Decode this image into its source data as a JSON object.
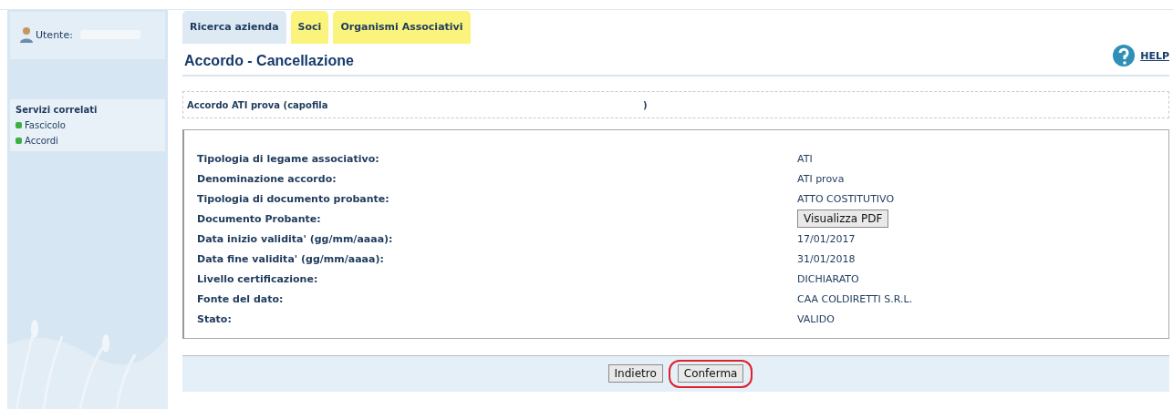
{
  "sidebar": {
    "user_label": "Utente:",
    "section_title": "Servizi correlati",
    "items": [
      {
        "label": "Fascicolo",
        "color": "#3cb043"
      },
      {
        "label": "Accordi",
        "color": "#3cb043"
      }
    ]
  },
  "tabs": [
    {
      "label": "Ricerca azienda",
      "color": "#dde9f3"
    },
    {
      "label": "Soci",
      "color": "#fbf47c"
    },
    {
      "label": "Organismi Associativi",
      "color": "#fbf47c"
    }
  ],
  "page_title": "Accordo - Cancellazione",
  "help": "HELP",
  "summary": {
    "text": "Accordo ATI prova (capofila",
    "closing": ")"
  },
  "fields": [
    {
      "kind": "text",
      "label": "Tipologia di legame associativo:",
      "value": "ATI"
    },
    {
      "kind": "text",
      "label": "Denominazione accordo:",
      "value": "ATI prova"
    },
    {
      "kind": "text",
      "label": "Tipologia di documento probante:",
      "value": "ATTO COSTITUTIVO"
    },
    {
      "kind": "button",
      "label": "Documento Probante:",
      "value": "Visualizza PDF"
    },
    {
      "kind": "text",
      "label": "Data inizio validita' (gg/mm/aaaa):",
      "value": "17/01/2017"
    },
    {
      "kind": "text",
      "label": "Data fine validita' (gg/mm/aaaa):",
      "value": "31/01/2018"
    },
    {
      "kind": "text",
      "label": "Livello certificazione:",
      "value": "DICHIARATO"
    },
    {
      "kind": "text",
      "label": "Fonte del dato:",
      "value": "CAA COLDIRETTI S.R.L."
    },
    {
      "kind": "text",
      "label": "Stato:",
      "value": "VALIDO"
    }
  ],
  "buttons": [
    {
      "label": "Indietro",
      "highlighted": false
    },
    {
      "label": "Conferma",
      "highlighted": true
    }
  ]
}
